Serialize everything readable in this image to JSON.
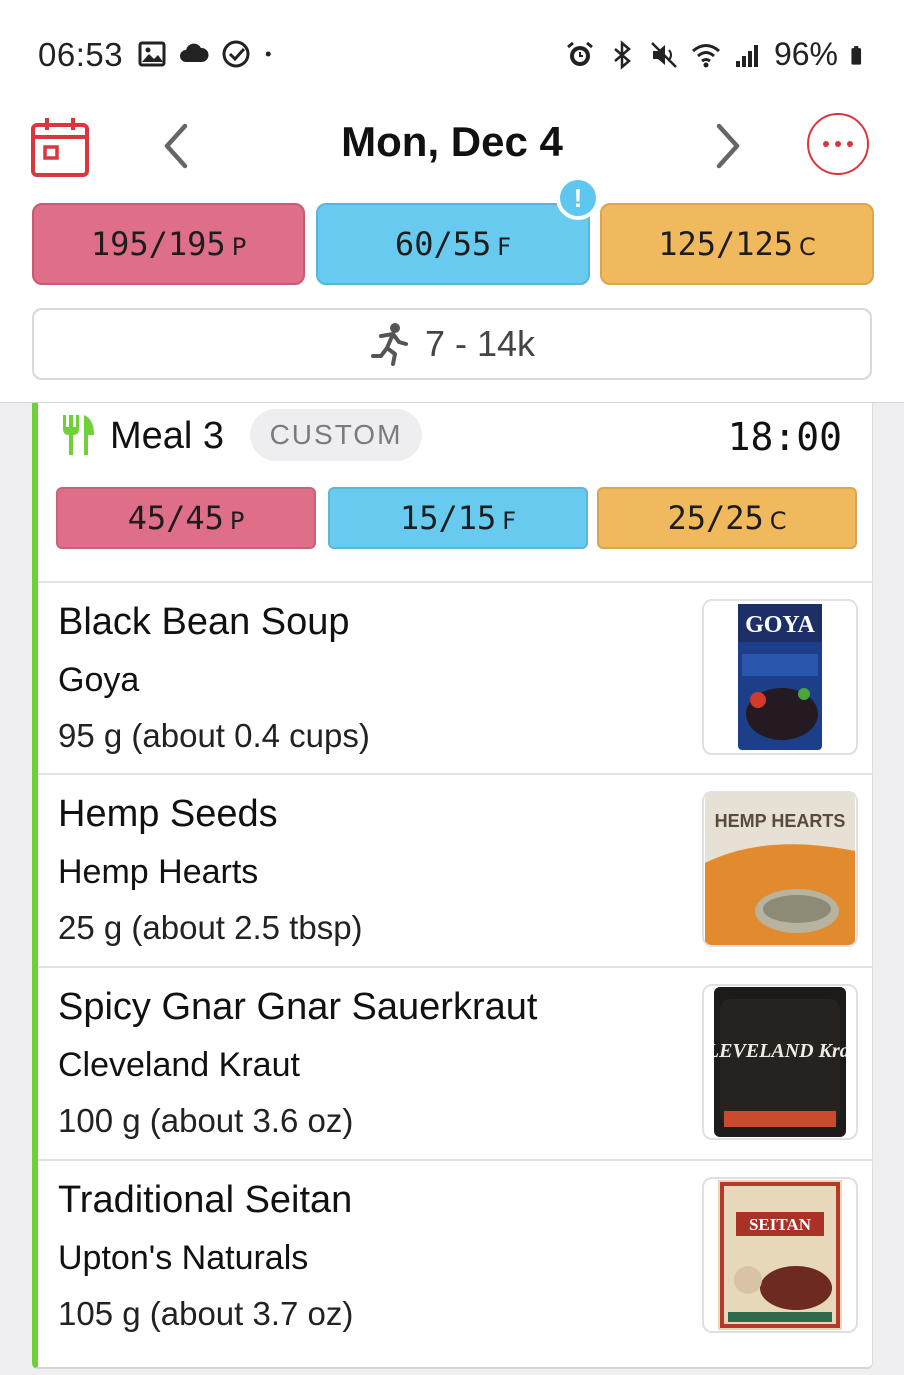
{
  "status_bar": {
    "time": "06:53",
    "battery": "96%",
    "left_icons": [
      "gallery-icon",
      "cloud-icon",
      "check-circle-icon",
      "dot-icon"
    ],
    "right_icons": [
      "alarm-icon",
      "bluetooth-icon",
      "mute-icon",
      "wifi-icon",
      "signal-icon",
      "battery-icon"
    ]
  },
  "header": {
    "date": "Mon, Dec 4"
  },
  "daily_macros": {
    "protein": {
      "value": "195/195",
      "unit": "P",
      "color": "#df6e89"
    },
    "fat": {
      "value": "60/55",
      "unit": "F",
      "color": "#69caf0",
      "alert": "!"
    },
    "carbs": {
      "value": "125/125",
      "unit": "C",
      "color": "#f1b95e"
    }
  },
  "steps": {
    "label": "7 - 14k"
  },
  "meal": {
    "title": "Meal 3",
    "tag": "CUSTOM",
    "time": "18:00",
    "accent": "#6fd13a",
    "macros": {
      "protein": {
        "value": "45/45",
        "unit": "P"
      },
      "fat": {
        "value": "15/15",
        "unit": "F"
      },
      "carbs": {
        "value": "25/25",
        "unit": "C"
      }
    },
    "foods": [
      {
        "name": "Black Bean Soup",
        "brand": "Goya",
        "amount": "95 g (about 0.4 cups)",
        "thumb_label": "GOYA"
      },
      {
        "name": "Hemp Seeds",
        "brand": "Hemp Hearts",
        "amount": "25 g (about 2.5 tbsp)",
        "thumb_label": "HEMP HEARTS"
      },
      {
        "name": "Spicy Gnar Gnar Sauerkraut",
        "brand": "Cleveland Kraut",
        "amount": "100 g (about 3.6 oz)",
        "thumb_label": "CLEVELAND Kraut"
      },
      {
        "name": "Traditional Seitan",
        "brand": "Upton's Naturals",
        "amount": "105 g (about 3.7 oz)",
        "thumb_label": "SEITAN"
      }
    ]
  }
}
